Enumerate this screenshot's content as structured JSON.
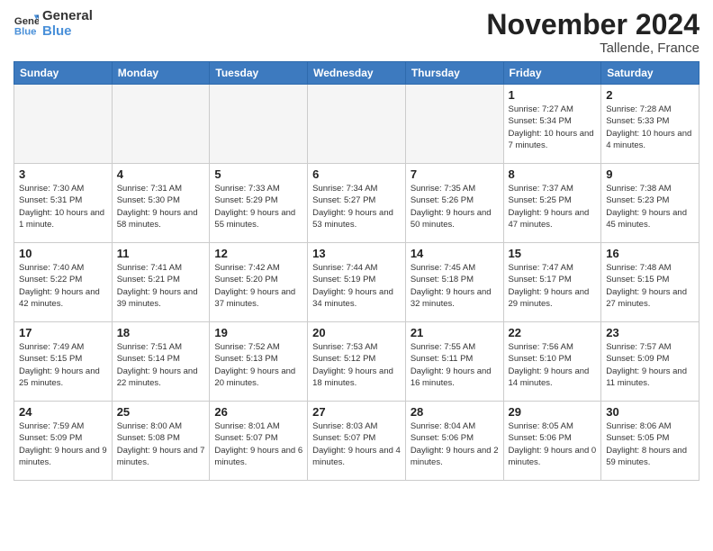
{
  "header": {
    "logo_line1": "General",
    "logo_line2": "Blue",
    "month": "November 2024",
    "location": "Tallende, France"
  },
  "weekdays": [
    "Sunday",
    "Monday",
    "Tuesday",
    "Wednesday",
    "Thursday",
    "Friday",
    "Saturday"
  ],
  "weeks": [
    [
      {
        "day": "",
        "info": ""
      },
      {
        "day": "",
        "info": ""
      },
      {
        "day": "",
        "info": ""
      },
      {
        "day": "",
        "info": ""
      },
      {
        "day": "",
        "info": ""
      },
      {
        "day": "1",
        "info": "Sunrise: 7:27 AM\nSunset: 5:34 PM\nDaylight: 10 hours and 7 minutes."
      },
      {
        "day": "2",
        "info": "Sunrise: 7:28 AM\nSunset: 5:33 PM\nDaylight: 10 hours and 4 minutes."
      }
    ],
    [
      {
        "day": "3",
        "info": "Sunrise: 7:30 AM\nSunset: 5:31 PM\nDaylight: 10 hours and 1 minute."
      },
      {
        "day": "4",
        "info": "Sunrise: 7:31 AM\nSunset: 5:30 PM\nDaylight: 9 hours and 58 minutes."
      },
      {
        "day": "5",
        "info": "Sunrise: 7:33 AM\nSunset: 5:29 PM\nDaylight: 9 hours and 55 minutes."
      },
      {
        "day": "6",
        "info": "Sunrise: 7:34 AM\nSunset: 5:27 PM\nDaylight: 9 hours and 53 minutes."
      },
      {
        "day": "7",
        "info": "Sunrise: 7:35 AM\nSunset: 5:26 PM\nDaylight: 9 hours and 50 minutes."
      },
      {
        "day": "8",
        "info": "Sunrise: 7:37 AM\nSunset: 5:25 PM\nDaylight: 9 hours and 47 minutes."
      },
      {
        "day": "9",
        "info": "Sunrise: 7:38 AM\nSunset: 5:23 PM\nDaylight: 9 hours and 45 minutes."
      }
    ],
    [
      {
        "day": "10",
        "info": "Sunrise: 7:40 AM\nSunset: 5:22 PM\nDaylight: 9 hours and 42 minutes."
      },
      {
        "day": "11",
        "info": "Sunrise: 7:41 AM\nSunset: 5:21 PM\nDaylight: 9 hours and 39 minutes."
      },
      {
        "day": "12",
        "info": "Sunrise: 7:42 AM\nSunset: 5:20 PM\nDaylight: 9 hours and 37 minutes."
      },
      {
        "day": "13",
        "info": "Sunrise: 7:44 AM\nSunset: 5:19 PM\nDaylight: 9 hours and 34 minutes."
      },
      {
        "day": "14",
        "info": "Sunrise: 7:45 AM\nSunset: 5:18 PM\nDaylight: 9 hours and 32 minutes."
      },
      {
        "day": "15",
        "info": "Sunrise: 7:47 AM\nSunset: 5:17 PM\nDaylight: 9 hours and 29 minutes."
      },
      {
        "day": "16",
        "info": "Sunrise: 7:48 AM\nSunset: 5:15 PM\nDaylight: 9 hours and 27 minutes."
      }
    ],
    [
      {
        "day": "17",
        "info": "Sunrise: 7:49 AM\nSunset: 5:15 PM\nDaylight: 9 hours and 25 minutes."
      },
      {
        "day": "18",
        "info": "Sunrise: 7:51 AM\nSunset: 5:14 PM\nDaylight: 9 hours and 22 minutes."
      },
      {
        "day": "19",
        "info": "Sunrise: 7:52 AM\nSunset: 5:13 PM\nDaylight: 9 hours and 20 minutes."
      },
      {
        "day": "20",
        "info": "Sunrise: 7:53 AM\nSunset: 5:12 PM\nDaylight: 9 hours and 18 minutes."
      },
      {
        "day": "21",
        "info": "Sunrise: 7:55 AM\nSunset: 5:11 PM\nDaylight: 9 hours and 16 minutes."
      },
      {
        "day": "22",
        "info": "Sunrise: 7:56 AM\nSunset: 5:10 PM\nDaylight: 9 hours and 14 minutes."
      },
      {
        "day": "23",
        "info": "Sunrise: 7:57 AM\nSunset: 5:09 PM\nDaylight: 9 hours and 11 minutes."
      }
    ],
    [
      {
        "day": "24",
        "info": "Sunrise: 7:59 AM\nSunset: 5:09 PM\nDaylight: 9 hours and 9 minutes."
      },
      {
        "day": "25",
        "info": "Sunrise: 8:00 AM\nSunset: 5:08 PM\nDaylight: 9 hours and 7 minutes."
      },
      {
        "day": "26",
        "info": "Sunrise: 8:01 AM\nSunset: 5:07 PM\nDaylight: 9 hours and 6 minutes."
      },
      {
        "day": "27",
        "info": "Sunrise: 8:03 AM\nSunset: 5:07 PM\nDaylight: 9 hours and 4 minutes."
      },
      {
        "day": "28",
        "info": "Sunrise: 8:04 AM\nSunset: 5:06 PM\nDaylight: 9 hours and 2 minutes."
      },
      {
        "day": "29",
        "info": "Sunrise: 8:05 AM\nSunset: 5:06 PM\nDaylight: 9 hours and 0 minutes."
      },
      {
        "day": "30",
        "info": "Sunrise: 8:06 AM\nSunset: 5:05 PM\nDaylight: 8 hours and 59 minutes."
      }
    ]
  ]
}
